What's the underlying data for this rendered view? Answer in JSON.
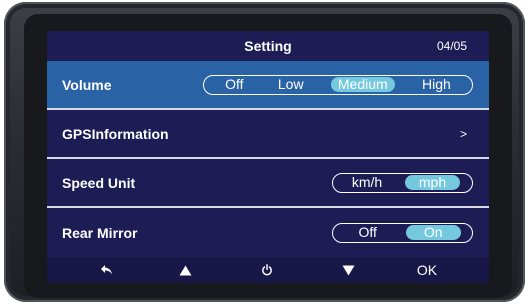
{
  "header": {
    "title": "Setting",
    "page": "04/05"
  },
  "rows": {
    "volume": {
      "label": "Volume",
      "options": [
        "Off",
        "Low",
        "Medium",
        "High"
      ],
      "selected": "Medium"
    },
    "gps": {
      "label": "GPSInformation",
      "chevron": ">"
    },
    "speed_unit": {
      "label": "Speed Unit",
      "options": [
        "km/h",
        "mph"
      ],
      "selected": "mph"
    },
    "rear_mirror": {
      "label": "Rear Mirror",
      "options": [
        "Off",
        "On"
      ],
      "selected": "On"
    }
  },
  "footer": {
    "buttons": [
      "back-icon",
      "up-arrow-icon",
      "power-icon",
      "down-arrow-icon",
      "OK"
    ],
    "ok_label": "OK"
  },
  "colors": {
    "screen_bg": "#1e1c55",
    "selected_row": "#2a62a6",
    "active_option": "#74c9de",
    "footer_bg": "#191747"
  }
}
